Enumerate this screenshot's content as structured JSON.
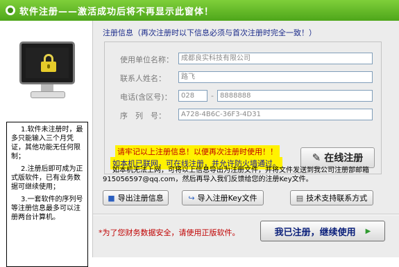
{
  "title_bar": {
    "text": "软件注册——激活成功后将不再显示此窗体！"
  },
  "notes": {
    "items": [
      "1.软件未注册时，最多只能输入三个月凭证，其他功能无任何限制；",
      "2.注册后即可成为正式版软件，已有业务数据可继续使用；",
      "3.一套软件的序列号等注册信息最多可以注册两台计算机。"
    ]
  },
  "form": {
    "heading": "注册信息（再次注册时以下信息必须与首次注册时完全一致！）",
    "unit_label": "使用单位名称：",
    "unit_value": "成都良实科技有限公司",
    "contact_label": "联系人姓名：",
    "contact_value": "路飞",
    "phone_label": "电话(含区号)：",
    "phone_area": "028",
    "phone_dash": "-",
    "phone_number": "8888888",
    "serial_label": "序　列　号：",
    "serial_value": "A728-4B6C-36F3-4D31"
  },
  "notices": {
    "remember": "请牢记以上注册信息！以便再次注册时使用！！",
    "online": "如本机已联网，可在线注册，并允许防火墙通过。"
  },
  "buttons": {
    "online_register": "在线注册",
    "export": "导出注册信息",
    "import": "导入注册Key文件",
    "contact": "技术支持联系方式",
    "confirm": "我已注册，继续使用"
  },
  "export_note": "如本机无法上网，可将以上信息导出为注册文件，并将文件发送到我公司注册部邮箱 915056597@qq.com，然后再导入我们反馈给您的注册Key文件。",
  "warning": "*为了您财务数据安全，请使用正版软件。",
  "icons": {
    "title": "app-icon",
    "monitor": "locked-monitor-icon",
    "online": "pen-icon",
    "export": "save-icon",
    "import": "import-arrow-icon",
    "contact": "keyboard-icon",
    "confirm": "play-arrow-icon"
  },
  "colors": {
    "title_bar": "#5cb52a",
    "highlight": "#fff200",
    "warning_text": "#c00000",
    "heading_text": "#1a2a8a"
  }
}
